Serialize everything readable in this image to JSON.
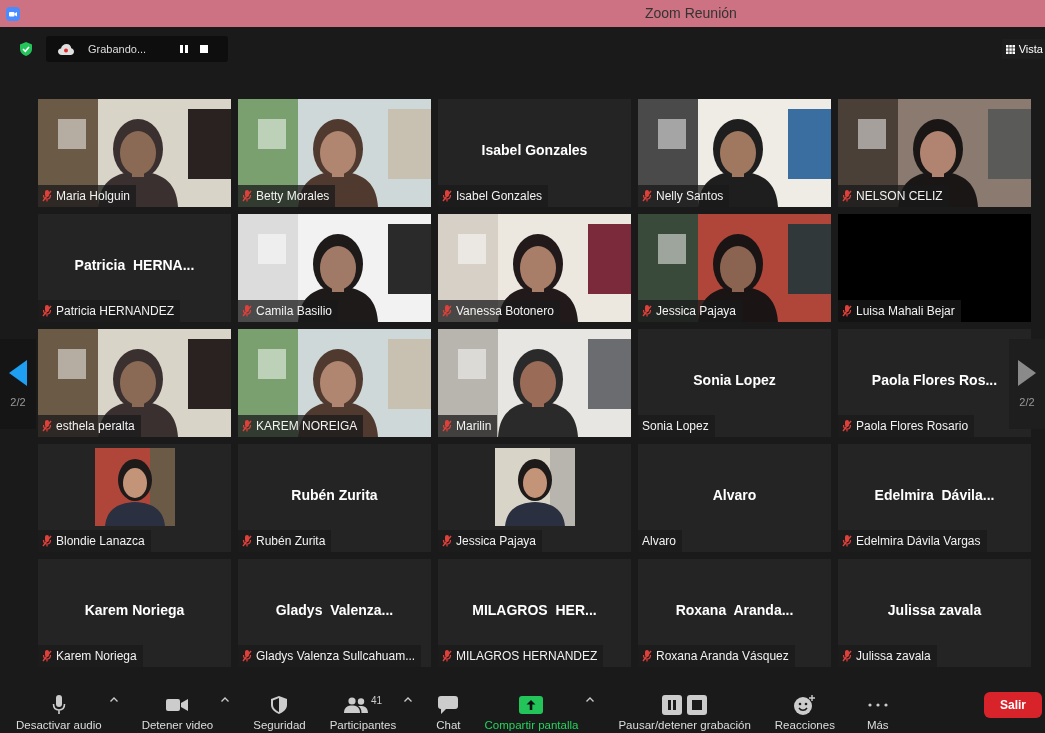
{
  "window": {
    "title": "Zoom Reunión"
  },
  "header": {
    "recording": "Grabando...",
    "view_button": "Vista"
  },
  "pager": {
    "left": "2/2",
    "right": "2/2"
  },
  "tiles": [
    {
      "kind": "video",
      "label": "Maria Holguin",
      "muted": true
    },
    {
      "kind": "video",
      "label": "Betty Morales",
      "muted": true
    },
    {
      "kind": "name",
      "display": "Isabel Gonzales",
      "label": "Isabel Gonzales",
      "muted": true
    },
    {
      "kind": "video",
      "label": "Nelly Santos",
      "muted": true
    },
    {
      "kind": "video",
      "label": "NELSON CELIZ",
      "muted": true
    },
    {
      "kind": "name",
      "display": "Patricia  HERNA...",
      "label": "Patricia HERNANDEZ",
      "muted": true
    },
    {
      "kind": "video",
      "label": "Camila Basilio",
      "muted": true
    },
    {
      "kind": "video",
      "label": "Vanessa Botonero",
      "muted": true
    },
    {
      "kind": "video",
      "label": "Jessica Pajaya",
      "muted": true
    },
    {
      "kind": "blank",
      "label": "Luisa Mahali Bejar",
      "muted": true
    },
    {
      "kind": "video",
      "label": "esthela peralta",
      "muted": true
    },
    {
      "kind": "video",
      "label": "KAREM NOREIGA",
      "muted": true
    },
    {
      "kind": "video",
      "label": "Marilin",
      "muted": true
    },
    {
      "kind": "name",
      "display": "Sonia Lopez",
      "label": "Sonia Lopez",
      "muted": false
    },
    {
      "kind": "name",
      "display": "Paola Flores Ros...",
      "label": "Paola Flores Rosario",
      "muted": true
    },
    {
      "kind": "avatar",
      "label": "Blondie Lanazca",
      "muted": true
    },
    {
      "kind": "name",
      "display": "Rubén Zurita",
      "label": "Rubén Zurita",
      "muted": true
    },
    {
      "kind": "avatar",
      "label": "Jessica Pajaya",
      "muted": true
    },
    {
      "kind": "name",
      "display": "Alvaro",
      "label": "Alvaro",
      "muted": false
    },
    {
      "kind": "name",
      "display": "Edelmira  Dávila...",
      "label": "Edelmira Dávila Vargas",
      "muted": true
    },
    {
      "kind": "name",
      "display": "Karem Noriega",
      "label": "Karem Noriega",
      "muted": true
    },
    {
      "kind": "name",
      "display": "Gladys  Valenza...",
      "label": "Gladys Valenza Sullcahuam...",
      "muted": true
    },
    {
      "kind": "name",
      "display": "MILAGROS  HER...",
      "label": "MILAGROS HERNANDEZ",
      "muted": true
    },
    {
      "kind": "name",
      "display": "Roxana  Aranda...",
      "label": "Roxana Aranda Vásquez",
      "muted": true
    },
    {
      "kind": "name",
      "display": "Julissa zavala",
      "label": "Julissa zavala",
      "muted": true
    }
  ],
  "toolbar": {
    "items": [
      {
        "kind": "mic",
        "label": "Desactivar audio",
        "caret": true
      },
      {
        "kind": "camera",
        "label": "Detener video",
        "caret": true
      },
      {
        "kind": "shield",
        "label": "Seguridad",
        "caret": false
      },
      {
        "kind": "people",
        "label": "Participantes",
        "count": "41",
        "caret": true
      },
      {
        "kind": "chat",
        "label": "Chat",
        "caret": false
      },
      {
        "kind": "share",
        "label": "Compartir pantalla",
        "caret": true
      },
      {
        "kind": "record",
        "label": "Pausar/detener grabación",
        "caret": false
      },
      {
        "kind": "reaction",
        "label": "Reacciones",
        "caret": false
      },
      {
        "kind": "more",
        "label": "Más",
        "caret": false
      }
    ],
    "leave": "Salir"
  }
}
